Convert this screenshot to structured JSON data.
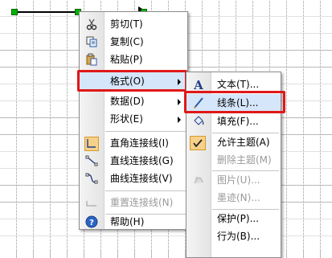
{
  "context_menu": {
    "items": [
      {
        "label": "剪切(T)",
        "icon": "scissors-icon"
      },
      {
        "label": "复制(C)",
        "icon": "copy-icon"
      },
      {
        "label": "粘贴(P)",
        "icon": "paste-icon"
      },
      {
        "label": "格式(O)",
        "submenu": true,
        "highlighted": true
      },
      {
        "label": "数据(D)",
        "submenu": true
      },
      {
        "label": "形状(E)",
        "submenu": true
      },
      {
        "label": "直角连接线(I)",
        "icon": "right-angle-connector-icon"
      },
      {
        "label": "直线连接线(G)",
        "icon": "straight-connector-icon"
      },
      {
        "label": "曲线连接线(V)",
        "icon": "curved-connector-icon"
      },
      {
        "label": "重置连接线(N)",
        "icon": "reset-connector-icon",
        "disabled": true
      },
      {
        "label": "帮助(H)",
        "icon": "help-icon"
      }
    ]
  },
  "format_submenu": {
    "items": [
      {
        "label": "文本(T)...",
        "icon": "text-format-icon"
      },
      {
        "label": "线条(L)...",
        "icon": "line-pen-icon",
        "highlighted": true
      },
      {
        "label": "填充(F)...",
        "icon": "fill-bucket-icon"
      },
      {
        "label": "允许主题(A)",
        "icon": "checkmark-icon"
      },
      {
        "label": "删除主题(M)",
        "disabled": true
      },
      {
        "label": "图片(U)...",
        "icon": "picture-icon",
        "disabled": true
      },
      {
        "label": "墨迹(N)...",
        "disabled": true
      },
      {
        "label": "保护(P)..."
      },
      {
        "label": "行为(B)..."
      }
    ]
  },
  "colors": {
    "highlight_border": "#e01818",
    "handle": "#00b300"
  }
}
